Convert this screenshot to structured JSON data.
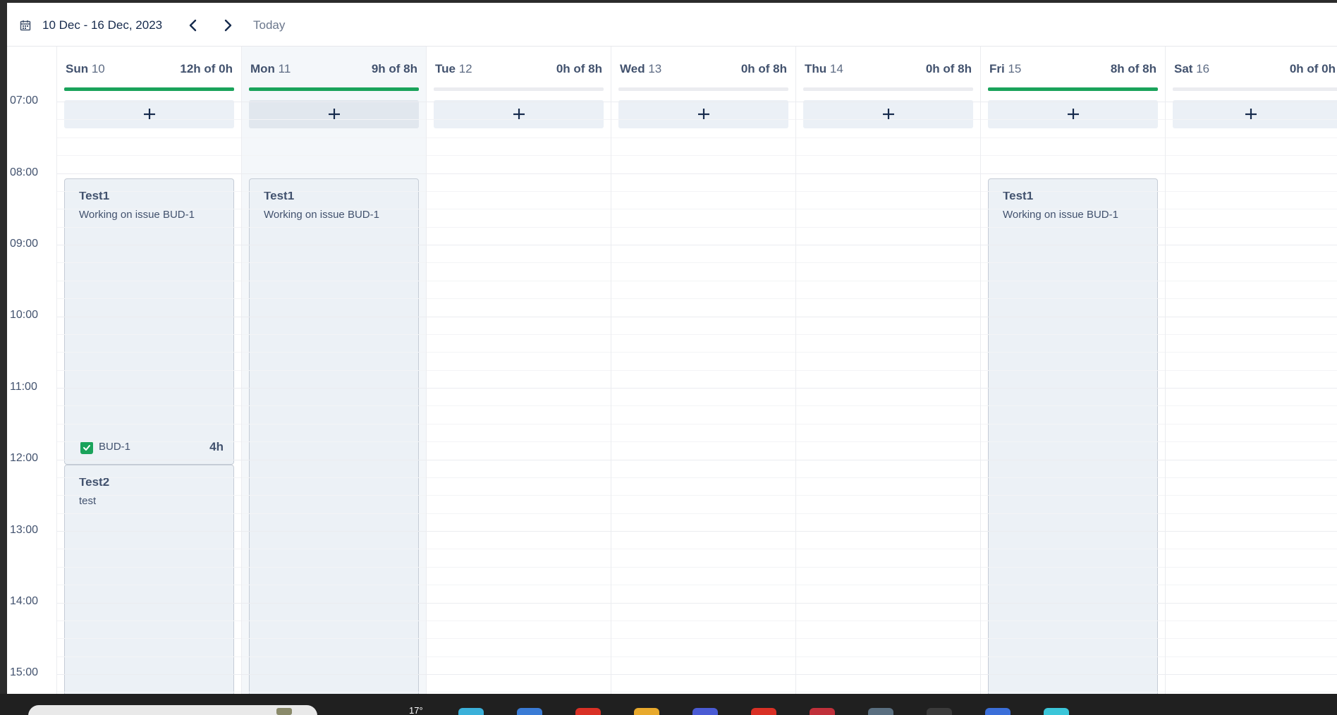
{
  "toolbar": {
    "date_range": "10 Dec - 16 Dec, 2023",
    "today_label": "Today",
    "calendar_icon": "calendar-icon",
    "prev_icon": "chevron-left-icon",
    "next_icon": "chevron-right-icon"
  },
  "time_labels": [
    "07:00",
    "08:00",
    "09:00",
    "10:00",
    "11:00",
    "12:00",
    "13:00",
    "14:00",
    "15:00"
  ],
  "days": [
    {
      "name": "Sun",
      "num": "10",
      "hours": "12h of 0h",
      "progress": 1.0
    },
    {
      "name": "Mon",
      "num": "11",
      "hours": "9h of 8h",
      "progress": 1.0
    },
    {
      "name": "Tue",
      "num": "12",
      "hours": "0h of 8h",
      "progress": 0
    },
    {
      "name": "Wed",
      "num": "13",
      "hours": "0h of 8h",
      "progress": 0
    },
    {
      "name": "Thu",
      "num": "14",
      "hours": "0h of 8h",
      "progress": 0
    },
    {
      "name": "Fri",
      "num": "15",
      "hours": "8h of 8h",
      "progress": 1.0
    },
    {
      "name": "Sat",
      "num": "16",
      "hours": "0h of 0h",
      "progress": 0
    }
  ],
  "add_label": "+",
  "events": {
    "sun_test1": {
      "title": "Test1",
      "desc": "Working on issue BUD-1",
      "issue": "BUD-1",
      "duration": "4h"
    },
    "sun_test2": {
      "title": "Test2",
      "desc": "test"
    },
    "mon_test1": {
      "title": "Test1",
      "desc": "Working on issue BUD-1"
    },
    "fri_test1": {
      "title": "Test1",
      "desc": "Working on issue BUD-1"
    }
  },
  "taskbar": {
    "weather": "17°",
    "app_colors": [
      "#3bb0d9",
      "#3a7bd5",
      "#d93025",
      "#e8a92c",
      "#4a5bd4",
      "#d93025",
      "#c0303a",
      "#5a6f80",
      "#3b3b3b",
      "#3b6fd9",
      "#3bc6d9"
    ]
  }
}
